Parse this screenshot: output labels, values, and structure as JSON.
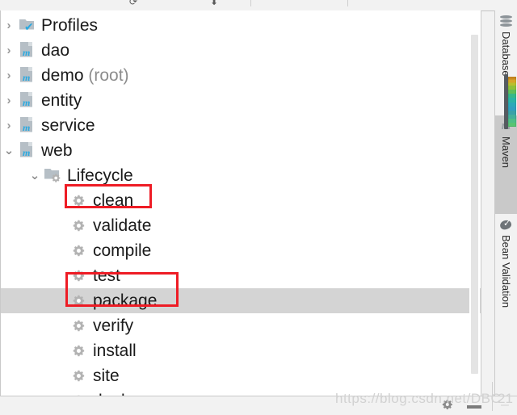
{
  "toolbar": {
    "icons": [
      "refresh-icon",
      "download-icon",
      "separator",
      "separator",
      "collapse-all-icon",
      "run-icon",
      "settings-icon",
      "separator"
    ]
  },
  "tree": {
    "rows": [
      {
        "label": "Profiles",
        "suffix": "",
        "indent": 0,
        "chevron": "right",
        "icon": "profiles-folder-icon",
        "name": "tree-row-profiles"
      },
      {
        "label": "dao",
        "suffix": "",
        "indent": 0,
        "chevron": "right",
        "icon": "maven-module-icon",
        "name": "tree-row-dao"
      },
      {
        "label": "demo",
        "suffix": "(root)",
        "indent": 0,
        "chevron": "right",
        "icon": "maven-module-icon",
        "name": "tree-row-demo"
      },
      {
        "label": "entity",
        "suffix": "",
        "indent": 0,
        "chevron": "right",
        "icon": "maven-module-icon",
        "name": "tree-row-entity"
      },
      {
        "label": "service",
        "suffix": "",
        "indent": 0,
        "chevron": "right",
        "icon": "maven-module-icon",
        "name": "tree-row-service"
      },
      {
        "label": "web",
        "suffix": "",
        "indent": 0,
        "chevron": "down",
        "icon": "maven-module-icon",
        "name": "tree-row-web"
      },
      {
        "label": "Lifecycle",
        "suffix": "",
        "indent": 1,
        "chevron": "down",
        "icon": "lifecycle-folder-icon",
        "name": "tree-row-lifecycle"
      },
      {
        "label": "clean",
        "suffix": "",
        "indent": 2,
        "chevron": "none",
        "icon": "maven-goal-gear-icon",
        "name": "tree-row-clean"
      },
      {
        "label": "validate",
        "suffix": "",
        "indent": 2,
        "chevron": "none",
        "icon": "maven-goal-gear-icon",
        "name": "tree-row-validate"
      },
      {
        "label": "compile",
        "suffix": "",
        "indent": 2,
        "chevron": "none",
        "icon": "maven-goal-gear-icon",
        "name": "tree-row-compile"
      },
      {
        "label": "test",
        "suffix": "",
        "indent": 2,
        "chevron": "none",
        "icon": "maven-goal-gear-icon",
        "name": "tree-row-test"
      },
      {
        "label": "package",
        "suffix": "",
        "indent": 2,
        "chevron": "none",
        "icon": "maven-goal-gear-icon",
        "name": "tree-row-package"
      },
      {
        "label": "verify",
        "suffix": "",
        "indent": 2,
        "chevron": "none",
        "icon": "maven-goal-gear-icon",
        "name": "tree-row-verify"
      },
      {
        "label": "install",
        "suffix": "",
        "indent": 2,
        "chevron": "none",
        "icon": "maven-goal-gear-icon",
        "name": "tree-row-install"
      },
      {
        "label": "site",
        "suffix": "",
        "indent": 2,
        "chevron": "none",
        "icon": "maven-goal-gear-icon",
        "name": "tree-row-site"
      },
      {
        "label": "deploy",
        "suffix": "",
        "indent": 2,
        "chevron": "none",
        "icon": "maven-goal-gear-icon",
        "name": "tree-row-deploy"
      }
    ],
    "selected_row": "package",
    "chevron_right_glyph": "›",
    "chevron_down_glyph": "⌄"
  },
  "annotations": {
    "highlight_color": "#ee1c25",
    "boxes": [
      {
        "target": "clean",
        "label": "clean"
      },
      {
        "target": "package",
        "label": "package"
      }
    ]
  },
  "right_stripe": {
    "tabs": [
      {
        "label": "Database",
        "icon": "database-icon",
        "active": false,
        "name": "tool-tab-database"
      },
      {
        "label": "Maven",
        "icon": "maven-m-icon",
        "active": true,
        "name": "tool-tab-maven"
      },
      {
        "label": "Bean Validation",
        "icon": "bean-validation-icon",
        "active": false,
        "name": "tool-tab-bean-validation"
      }
    ]
  },
  "bottom": {
    "gear_icon": "settings-gear-icon",
    "minimize_icon": "minimize-icon"
  },
  "watermark": {
    "text": "https://blog.csdn.net/DBC_",
    "number": "21"
  }
}
